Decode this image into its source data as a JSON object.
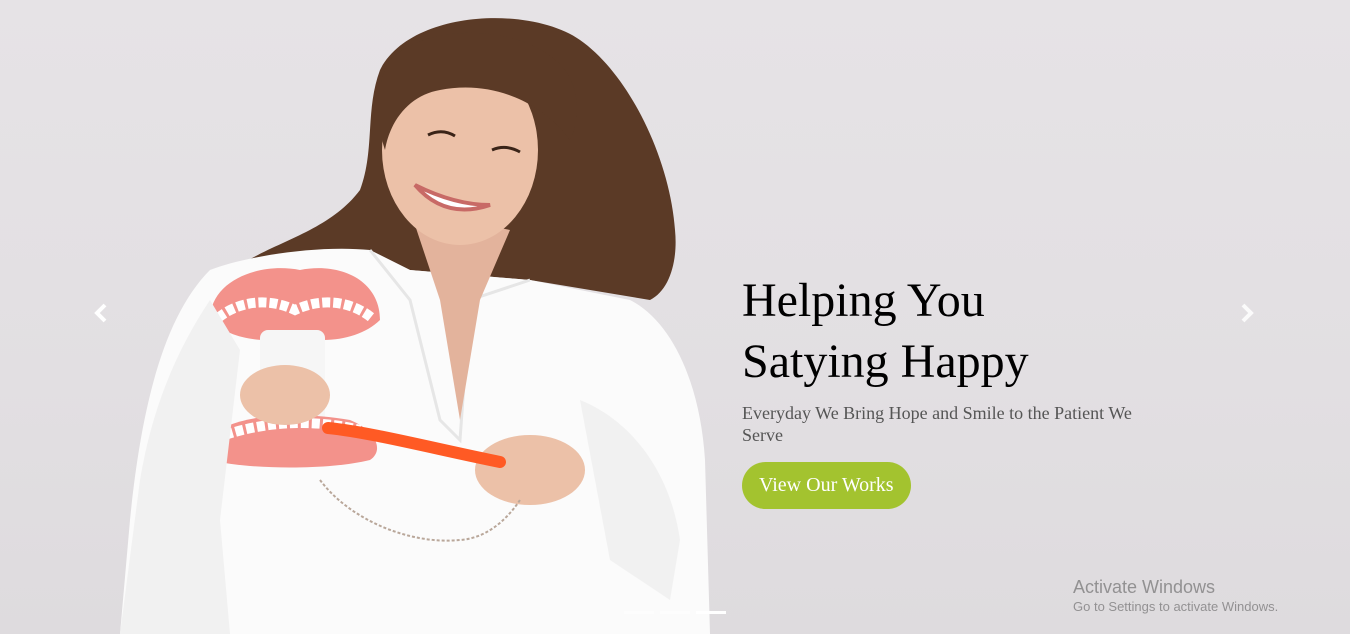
{
  "slider": {
    "headline_line1": "Helping You",
    "headline_line2": "Satying Happy",
    "subtext": "Everyday We Bring Hope and Smile to the Patient We Serve",
    "cta_label": "View Our Works",
    "accent_color": "#a3c32f",
    "indicator_count": 3,
    "active_indicator": 3,
    "prev_icon": "chevron-left-icon",
    "next_icon": "chevron-right-icon"
  },
  "watermark": {
    "title": "Activate Windows",
    "subtitle": "Go to Settings to activate Windows."
  }
}
